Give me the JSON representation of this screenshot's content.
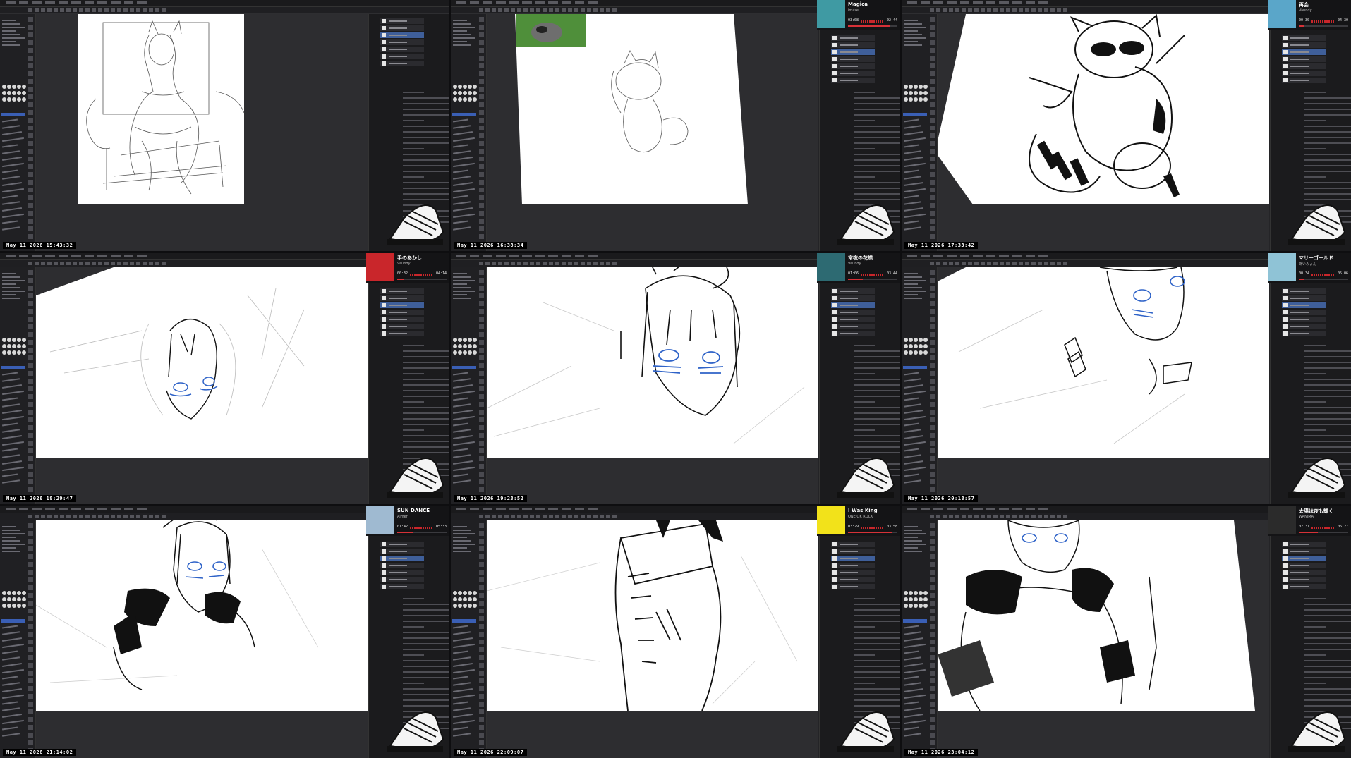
{
  "panels": [
    {
      "timestamp": "May 11 2026 15:43:32",
      "music": null
    },
    {
      "timestamp": "May 11 2026 16:38:34",
      "music": {
        "title": "Magica",
        "artist": "imase",
        "elapsed": "03:08",
        "duration": "02:44",
        "progress": 0.85,
        "art_color": "#3f9aa3"
      }
    },
    {
      "timestamp": "May 11 2026 17:33:42",
      "music": {
        "title": "再会",
        "artist": "Vaundy",
        "elapsed": "00:30",
        "duration": "04:30",
        "progress": 0.11,
        "art_color": "#5aa6c9"
      }
    },
    {
      "timestamp": "May 11 2026 18:29:47",
      "music": {
        "title": "手のあかし",
        "artist": "Vaundy",
        "elapsed": "00:32",
        "duration": "04:14",
        "progress": 0.13,
        "art_color": "#c9262b"
      }
    },
    {
      "timestamp": "May 11 2026 19:23:52",
      "music": {
        "title": "常夜の花蝶",
        "artist": "Vaundy",
        "elapsed": "01:06",
        "duration": "03:44",
        "progress": 0.3,
        "art_color": "#2d6a72"
      }
    },
    {
      "timestamp": "May 11 2026 20:18:57",
      "music": {
        "title": "マリーゴールド",
        "artist": "あいみょん",
        "elapsed": "00:34",
        "duration": "05:06",
        "progress": 0.11,
        "art_color": "#8fc3d6"
      }
    },
    {
      "timestamp": "May 11 2026 21:14:02",
      "music": {
        "title": "SUN DANCE",
        "artist": "Aimer",
        "elapsed": "01:42",
        "duration": "05:33",
        "progress": 0.31,
        "art_color": "#9fbad1"
      }
    },
    {
      "timestamp": "May 11 2026 22:09:07",
      "music": {
        "title": "I Was King",
        "artist": "ONE OK ROCK",
        "elapsed": "03:29",
        "duration": "03:58",
        "progress": 0.88,
        "art_color": "#f2e21a"
      }
    },
    {
      "timestamp": "May 11 2026 23:04:12",
      "music": {
        "title": "太陽は夜も輝く",
        "artist": "WANIMA",
        "elapsed": "02:31",
        "duration": "06:27",
        "progress": 0.39,
        "art_color": "#2b2b2b"
      }
    }
  ],
  "colors": {
    "accent": "#d63137",
    "eye_blue": "#2f63c8",
    "ui_bg": "#242427",
    "paper": "#ffffff"
  }
}
